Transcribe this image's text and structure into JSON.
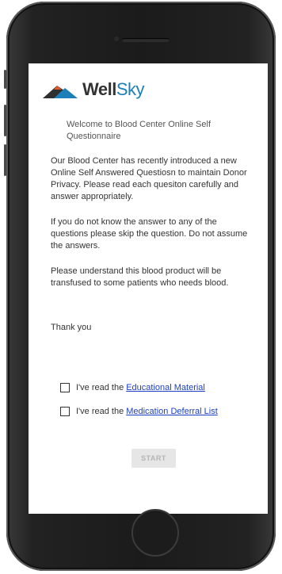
{
  "brand": {
    "name_main": "Well",
    "name_accent": "Sky",
    "colors": {
      "dark": "#2f2f2f",
      "accent": "#e05a2b",
      "blue": "#1d7fb7"
    }
  },
  "welcome": "Welcome to Blood Center Online Self Questionnaire",
  "intro": "Our Blood Center has recently introduced a new Online Self Answered Questiosn to maintain Donor Privacy. Please read each quesiton carefully and answer appropriately.",
  "skip_note": "If you do not know the answer to any of the questions please skip the question. Do not assume the answers.",
  "transfusion_note": "Please understand this blood product will be transfused to some patients who needs blood.",
  "thanks": "Thank you",
  "checkboxes": [
    {
      "prefix": "I've read the",
      "link": "Educational Material",
      "checked": false
    },
    {
      "prefix": "I've read the",
      "link": "Medication Deferral List",
      "checked": false
    }
  ],
  "start_button": {
    "label": "START",
    "enabled": false
  }
}
